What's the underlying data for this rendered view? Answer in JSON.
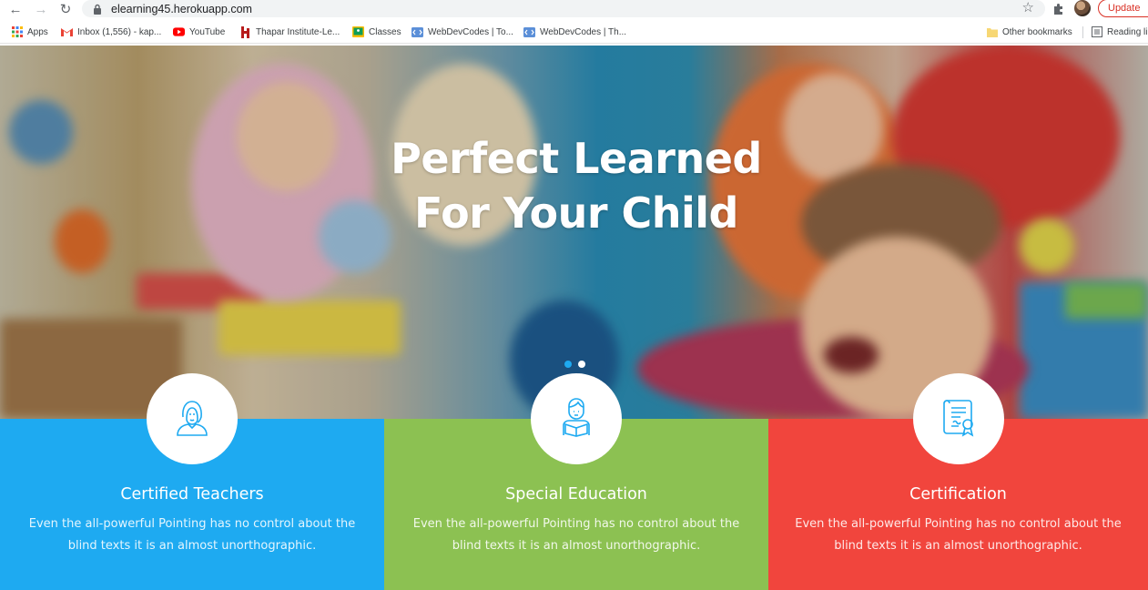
{
  "browser": {
    "url": "elearning45.herokuapp.com",
    "update_label": "Update",
    "back_icon": "arrow-left-icon",
    "forward_icon": "arrow-right-icon",
    "reload_icon": "reload-icon"
  },
  "bookmarks": {
    "items": [
      {
        "label": "Apps",
        "icon": "apps-grid-icon"
      },
      {
        "label": "Inbox (1,556) - kap...",
        "icon": "gmail-icon"
      },
      {
        "label": "YouTube",
        "icon": "youtube-icon"
      },
      {
        "label": "Thapar Institute-Le...",
        "icon": "thapar-icon"
      },
      {
        "label": "Classes",
        "icon": "classroom-icon"
      },
      {
        "label": "WebDevCodes | To...",
        "icon": "webdevcodes-icon"
      },
      {
        "label": "WebDevCodes | Th...",
        "icon": "webdevcodes-icon"
      }
    ],
    "other_bookmarks": "Other bookmarks",
    "reading_list": "Reading li"
  },
  "hero": {
    "title_line1": "Perfect Learned",
    "title_line2": "For Your Child",
    "slides_count": 2,
    "active_slide": 1
  },
  "features": [
    {
      "title": "Certified Teachers",
      "text": "Even the all-powerful Pointing has no control about the blind texts it is an almost unorthographic.",
      "color": "#1eaaf1",
      "icon": "teacher-icon"
    },
    {
      "title": "Special Education",
      "text": "Even the all-powerful Pointing has no control about the blind texts it is an almost unorthographic.",
      "color": "#8cc152",
      "icon": "student-reading-icon"
    },
    {
      "title": "Certification",
      "text": "Even the all-powerful Pointing has no control about the blind texts it is an almost unorthographic.",
      "color": "#f1453d",
      "icon": "certificate-icon"
    }
  ],
  "colors": {
    "accent_blue": "#1eaaf1",
    "accent_green": "#8cc152",
    "accent_red": "#f1453d"
  }
}
